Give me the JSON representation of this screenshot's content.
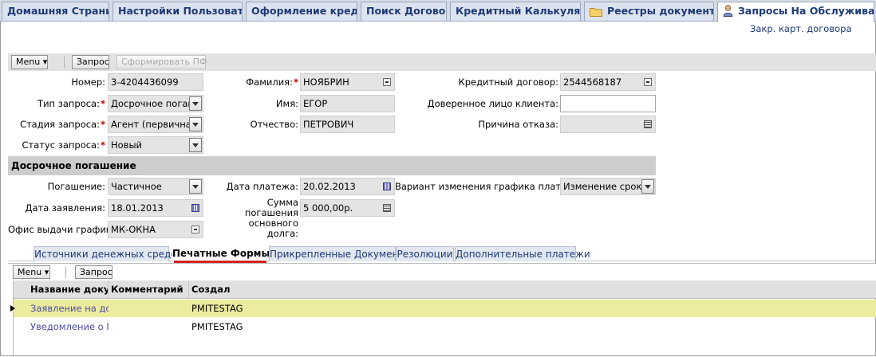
{
  "top_tabs": [
    {
      "label": "Домашняя Страница",
      "active": false
    },
    {
      "label": "Настройки Пользователя",
      "active": false
    },
    {
      "label": "Оформление кредита",
      "active": false
    },
    {
      "label": "Поиск Договора",
      "active": false
    },
    {
      "label": "Кредитный Калькулятор",
      "active": false
    },
    {
      "label": "Реестры документов",
      "active": false,
      "icon": "folder-icon"
    },
    {
      "label": "Запросы На Обслуживание",
      "active": true,
      "icon": "user-icon"
    }
  ],
  "sublink": "Закр. карт. договора",
  "toolbar": {
    "menu_label": "Menu",
    "query_label": "Запрос",
    "generate_label": "Сформировать ПФ"
  },
  "form": {
    "number": {
      "label": "Номер:",
      "value": "3-4204436099"
    },
    "request_type": {
      "label": "Тип запроса:",
      "value": "Досрочное погаш."
    },
    "request_stage": {
      "label": "Стадия запроса:",
      "value": "Агент (первичная"
    },
    "request_status": {
      "label": "Статус запроса:",
      "value": "Новый"
    },
    "last_name": {
      "label": "Фамилия:",
      "value": "НОЯБРИН"
    },
    "first_name": {
      "label": "Имя:",
      "value": "ЕГОР"
    },
    "middle_name": {
      "label": "Отчество:",
      "value": "ПЕТРОВИЧ"
    },
    "credit_contract": {
      "label": "Кредитный договор:",
      "value": "2544568187"
    },
    "trustee": {
      "label": "Доверенное лицо клиента:",
      "value": ""
    },
    "rejection_reason": {
      "label": "Причина отказа:",
      "value": ""
    }
  },
  "section": {
    "title": "Досрочное погашение",
    "repayment": {
      "label": "Погашение:",
      "value": "Частичное"
    },
    "application_date": {
      "label": "Дата заявления:",
      "value": "18.01.2013"
    },
    "schedule_office": {
      "label": "Офис выдачи графика:",
      "value": "МК-ОКНА"
    },
    "payment_date": {
      "label": "Дата платежа:",
      "value": "20.02.2013"
    },
    "principal_amount": {
      "label": "Сумма погашения основного долга:",
      "value": "5 000,00р."
    },
    "schedule_change": {
      "label": "Вариант изменения графика платежей:",
      "value": "Изменение срока к"
    }
  },
  "sub_tabs": [
    {
      "label": "Источники денежных средств",
      "active": false
    },
    {
      "label": "Печатные Формы",
      "active": true
    },
    {
      "label": "Прикрепленные Документы",
      "active": false
    },
    {
      "label": "Резолюции",
      "active": false
    },
    {
      "label": "Дополнительные платежи",
      "active": false
    }
  ],
  "applet": {
    "menu_label": "Menu",
    "query_label": "Запрос",
    "columns": [
      "Название докум",
      "Комментарий",
      "Создал"
    ],
    "rows": [
      {
        "name": "Заявление на доср",
        "comment": "",
        "created_by": "PMITESTAG",
        "selected": true
      },
      {
        "name": "Уведомление о ПСК",
        "comment": "",
        "created_by": "PMITESTAG",
        "selected": false
      }
    ]
  },
  "colors": {
    "link": "#1c3a77",
    "required": "#c00000",
    "selected_row": "#ecec9e",
    "active_tab_underline": "#d62020"
  }
}
